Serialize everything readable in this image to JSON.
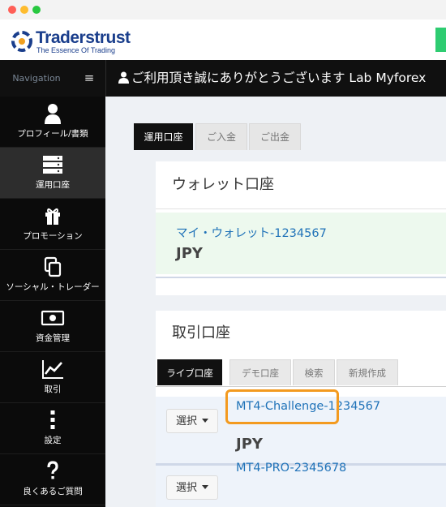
{
  "header": {
    "logo_name": "Traderstrust",
    "logo_tagline": "The Essence Of Trading"
  },
  "topbar": {
    "nav_label": "Navigation",
    "menu_glyph": "≡",
    "welcome": "ご利用頂き誠にありがとうございます Lab Myforex"
  },
  "sidebar": {
    "items": [
      {
        "label": "プロフィール/書類",
        "icon": "user-icon"
      },
      {
        "label": "運用口座",
        "icon": "server-icon"
      },
      {
        "label": "プロモーション",
        "icon": "gift-icon"
      },
      {
        "label": "ソーシャル・トレーダー",
        "icon": "copy-icon"
      },
      {
        "label": "資金管理",
        "icon": "money-icon"
      },
      {
        "label": "取引",
        "icon": "chart-line-icon"
      },
      {
        "label": "設定",
        "icon": "ellipsis-vertical-icon"
      },
      {
        "label": "良くあるご質問",
        "icon": "question-icon"
      }
    ]
  },
  "main": {
    "tabs": [
      {
        "label": "運用口座"
      },
      {
        "label": "ご入金"
      },
      {
        "label": "ご出金"
      }
    ],
    "wallet_panel": {
      "title": "ウォレット口座",
      "wallet_link": "マイ・ウォレット-1234567",
      "currency": "JPY"
    },
    "trading_panel": {
      "title": "取引口座",
      "tabs": [
        {
          "label": "ライブ口座"
        },
        {
          "label": "デモ口座"
        },
        {
          "label": "検索"
        },
        {
          "label": "新規作成"
        }
      ],
      "rows": [
        {
          "select_label": "選択",
          "account": "MT4-Challenge-1234567",
          "currency": "JPY"
        },
        {
          "select_label": "選択",
          "account": "MT4-PRO-2345678"
        }
      ]
    }
  },
  "colors": {
    "accent_highlight": "#f39a1f",
    "link": "#1f72b8",
    "brand": "#1a3e8c"
  }
}
